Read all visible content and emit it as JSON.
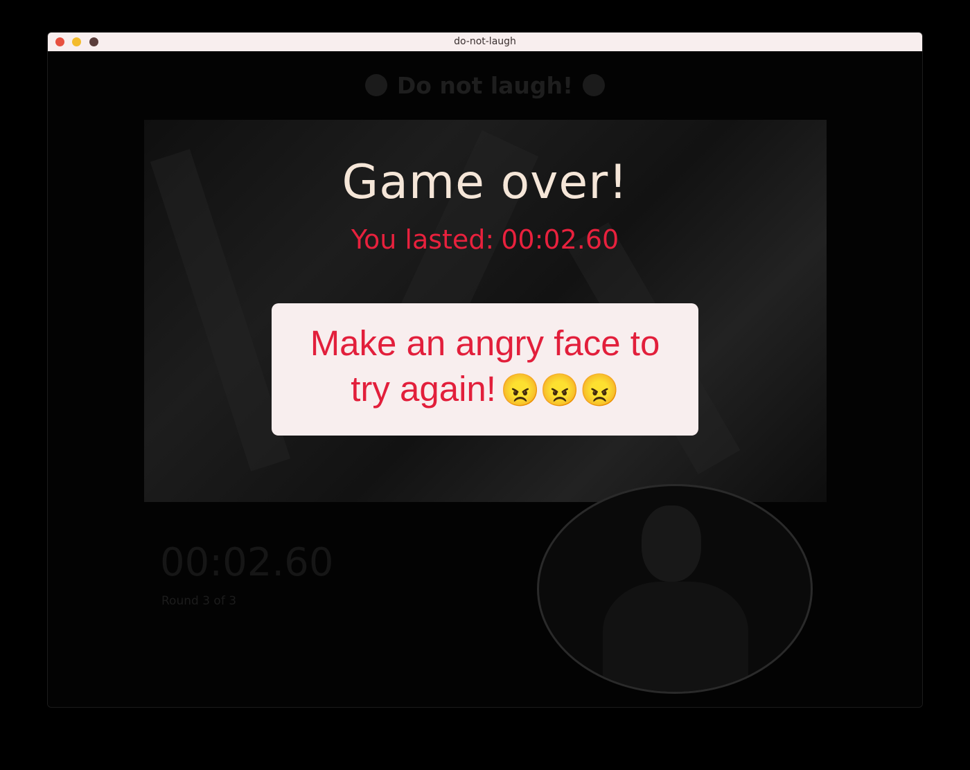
{
  "window": {
    "title": "do-not-laugh"
  },
  "app": {
    "heading": "Do not laugh!"
  },
  "overlay": {
    "title": "Game over!",
    "lasted_label": "You lasted:",
    "lasted_value": "00:02.60",
    "prompt_line1": "Make an angry face to",
    "prompt_line2": "try again!",
    "prompt_emoji": "😠😠😠"
  },
  "background_game": {
    "timer": "00:02.60",
    "round": "Round 3 of 3"
  },
  "colors": {
    "accent_red": "#e21f3b",
    "title_cream": "#f5e6d8",
    "card_background": "#f8eeee"
  }
}
